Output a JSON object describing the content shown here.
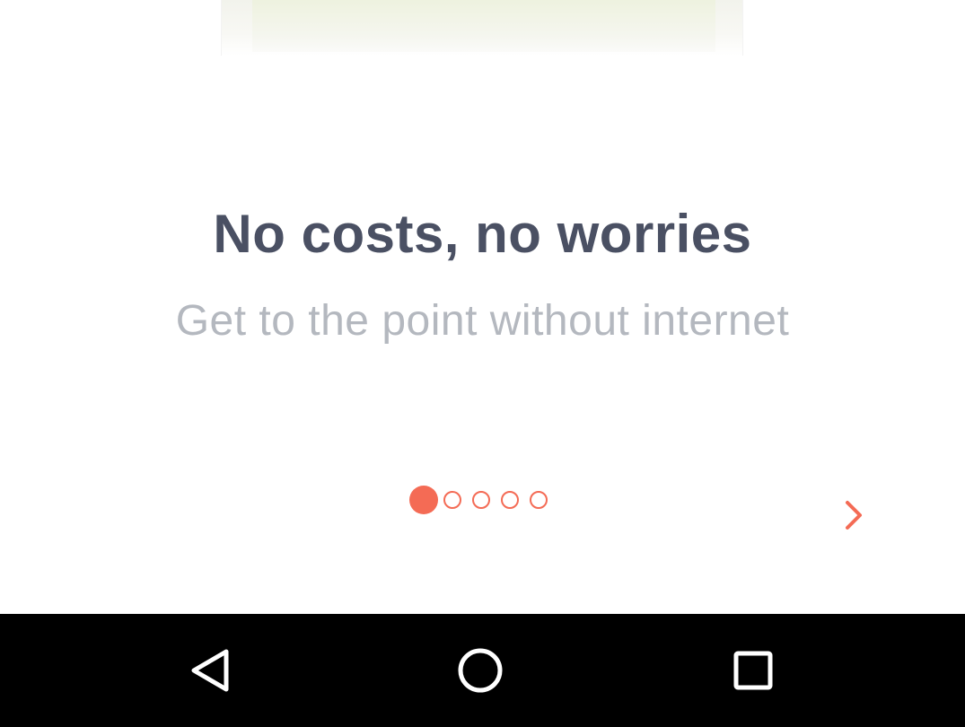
{
  "onboarding": {
    "title": "No costs, no worries",
    "subtitle": "Get to the point without internet",
    "pager": {
      "total": 5,
      "active_index": 0
    },
    "next_icon": "chevron-right-icon",
    "accent_color": "#f46b55"
  },
  "system_nav": {
    "back_icon": "back-triangle-icon",
    "home_icon": "home-circle-icon",
    "recents_icon": "recents-square-icon"
  }
}
